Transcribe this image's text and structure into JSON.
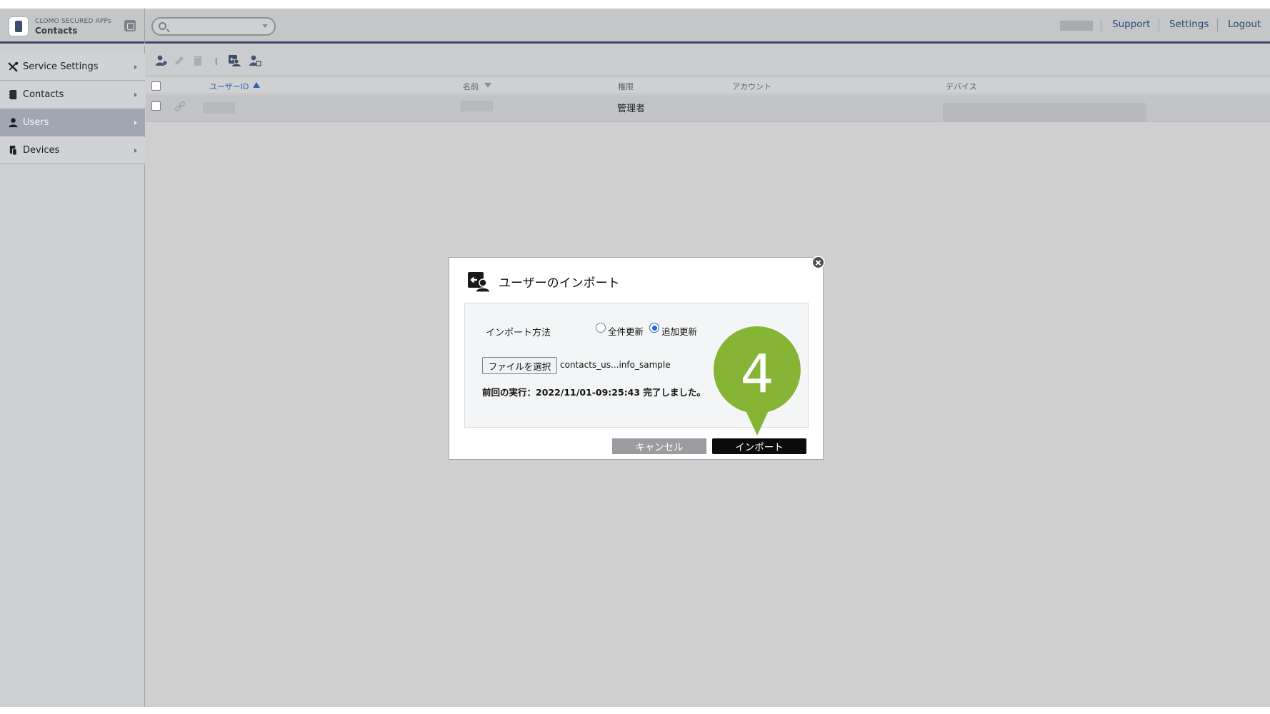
{
  "header": {
    "brand_top": "CLOMO SECURED APPs",
    "brand_bottom": "Contacts",
    "search_placeholder": "",
    "links": [
      "Support",
      "Settings",
      "Logout"
    ]
  },
  "sidebar": {
    "items": [
      {
        "label": "Service Settings",
        "icon": "tools-icon"
      },
      {
        "label": "Contacts",
        "icon": "contacts-book-icon"
      },
      {
        "label": "Users",
        "icon": "user-icon"
      },
      {
        "label": "Devices",
        "icon": "devices-icon"
      }
    ],
    "active": "Users"
  },
  "toolbar": {
    "icons": [
      "add-user-icon",
      "edit-pencil-icon",
      "delete-trash-icon",
      "import-users-icon",
      "export-users-icon"
    ]
  },
  "table": {
    "columns": [
      "ユーザーID",
      "名前",
      "権限",
      "アカウント",
      "デバイス"
    ],
    "sorted_column": "ユーザーID",
    "rows": [
      {
        "role": "管理者"
      }
    ]
  },
  "dialog": {
    "title": "ユーザーのインポート",
    "method_label": "インポート方法",
    "options": [
      "全件更新",
      "追加更新"
    ],
    "selected_option": "追加更新",
    "file_button": "ファイルを選択",
    "file_name": "contacts_us...info_sample",
    "last_run": "前回の実行：2022/11/01-09:25:43 完了しました。",
    "cancel": "キャンセル",
    "import": "インポート"
  },
  "marker": {
    "step": "4",
    "color": "#86b535"
  },
  "colors": {
    "header_accent": "#3a4a66",
    "link": "#2c4770",
    "sort_active": "#2f62b5",
    "radio_selected": "#2563d8"
  }
}
